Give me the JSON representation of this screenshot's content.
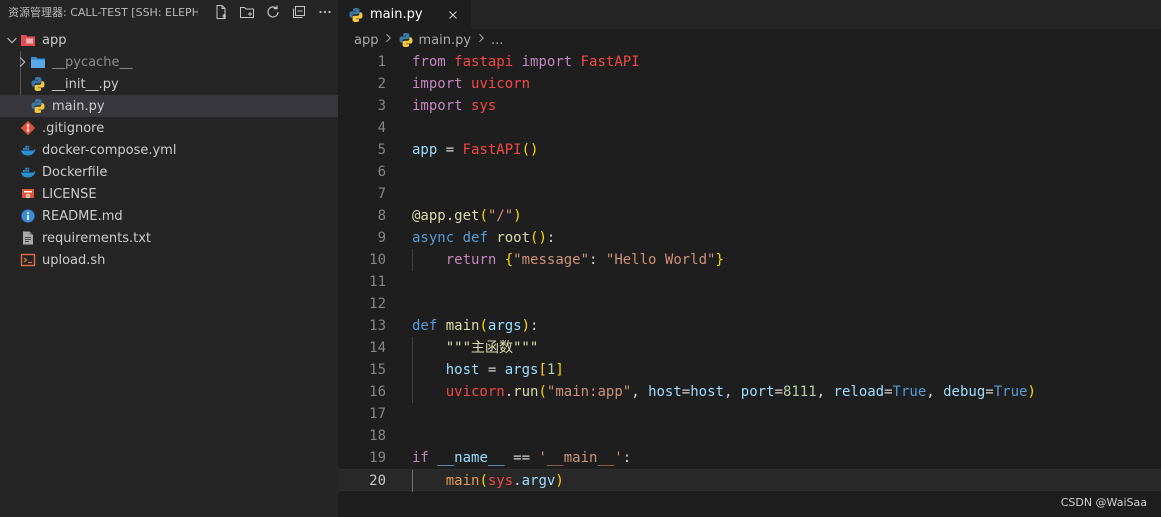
{
  "sidebar": {
    "title": "资源管理器: CALL-TEST [SSH: ELEPH...",
    "actions": [
      "new-file-icon",
      "new-folder-icon",
      "refresh-icon",
      "collapse-all-icon",
      "more-icon"
    ],
    "tree": [
      {
        "label": "app",
        "depth": 0,
        "type": "folder-open",
        "icon": "folder-app-icon"
      },
      {
        "label": "__pycache__",
        "depth": 1,
        "type": "folder-closed",
        "icon": "folder-icon",
        "dim": true
      },
      {
        "label": "__init__.py",
        "depth": 1,
        "type": "file",
        "icon": "python-icon"
      },
      {
        "label": "main.py",
        "depth": 1,
        "type": "file",
        "icon": "python-icon",
        "selected": true
      },
      {
        "label": ".gitignore",
        "depth": 0,
        "type": "file",
        "icon": "git-icon"
      },
      {
        "label": "docker-compose.yml",
        "depth": 0,
        "type": "file",
        "icon": "docker-icon"
      },
      {
        "label": "Dockerfile",
        "depth": 0,
        "type": "file",
        "icon": "docker-icon"
      },
      {
        "label": "LICENSE",
        "depth": 0,
        "type": "file",
        "icon": "license-icon"
      },
      {
        "label": "README.md",
        "depth": 0,
        "type": "file",
        "icon": "info-icon"
      },
      {
        "label": "requirements.txt",
        "depth": 0,
        "type": "file",
        "icon": "text-file-icon"
      },
      {
        "label": "upload.sh",
        "depth": 0,
        "type": "file",
        "icon": "terminal-icon"
      }
    ]
  },
  "editor": {
    "tab": {
      "label": "main.py",
      "icon": "python-icon"
    },
    "breadcrumb": [
      "app",
      "main.py",
      "..."
    ],
    "current_line": 20,
    "lines": [
      {
        "n": "1",
        "code": "from fastapi import FastAPI"
      },
      {
        "n": "2",
        "code": "import uvicorn"
      },
      {
        "n": "3",
        "code": "import sys"
      },
      {
        "n": "4",
        "code": ""
      },
      {
        "n": "5",
        "code": "app = FastAPI()"
      },
      {
        "n": "6",
        "code": ""
      },
      {
        "n": "7",
        "code": ""
      },
      {
        "n": "8",
        "code": "@app.get(\"/\")"
      },
      {
        "n": "9",
        "code": "async def root():"
      },
      {
        "n": "10",
        "code": "    return {\"message\": \"Hello World\"}"
      },
      {
        "n": "11",
        "code": ""
      },
      {
        "n": "12",
        "code": ""
      },
      {
        "n": "13",
        "code": "def main(args):"
      },
      {
        "n": "14",
        "code": "    \"\"\"主函数\"\"\""
      },
      {
        "n": "15",
        "code": "    host = args[1]"
      },
      {
        "n": "16",
        "code": "    uvicorn.run(\"main:app\", host=host, port=8111, reload=True, debug=True)"
      },
      {
        "n": "17",
        "code": ""
      },
      {
        "n": "18",
        "code": ""
      },
      {
        "n": "19",
        "code": "if __name__ == '__main__':"
      },
      {
        "n": "20",
        "code": "    main(sys.argv)"
      }
    ]
  },
  "watermark": "CSDN @WaiSaa"
}
